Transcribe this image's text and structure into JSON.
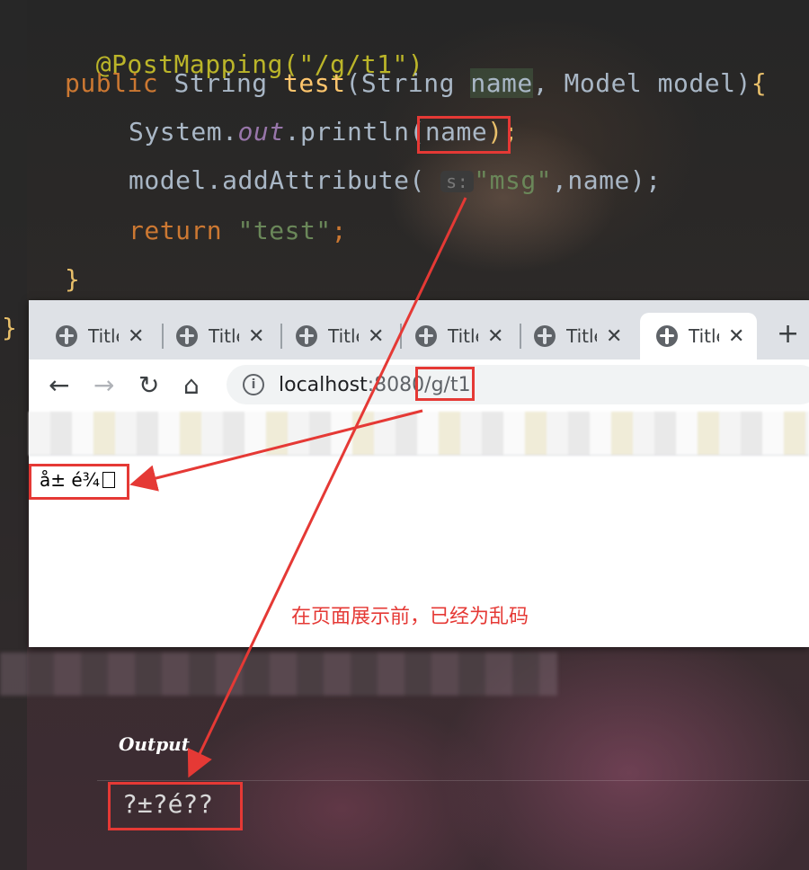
{
  "editor": {
    "annotation": "@PostMapping(\"/g/t1\")",
    "signature": {
      "kw": "public",
      "ret_type": "String",
      "method": "test",
      "param1_type": "String",
      "param1_name": "name",
      "param2_type": "Model",
      "param2_name": "model"
    },
    "line_println": {
      "obj": "System.",
      "field": "out",
      "call": ".println(",
      "arg": "name",
      "close": ");"
    },
    "line_addattr": {
      "prefix": "model.addAttribute(",
      "hint": "s:",
      "key": "\"msg\"",
      "rest": ",name);"
    },
    "line_return": {
      "kw": "return",
      "value": "\"test\"",
      "semi": ";"
    },
    "close_inner": "}",
    "close_outer": "}"
  },
  "browser": {
    "tabs": [
      {
        "title": "Title"
      },
      {
        "title": "Title"
      },
      {
        "title": "Title"
      },
      {
        "title": "Title"
      },
      {
        "title": "Title"
      },
      {
        "title": "Title",
        "active": true
      }
    ],
    "tab_close": "✕",
    "new_tab": "+",
    "nav": {
      "back": "←",
      "forward": "→",
      "reload": "↻",
      "home": "⌂"
    },
    "url_host": "localhost",
    "url_rest": ":8080/g/t1",
    "page_text": "å± é¾"
  },
  "annotation_note": "在页面展示前，已经为乱码",
  "output": {
    "label": "Output",
    "value": "?±?é??"
  },
  "colors": {
    "callout": "#e53935"
  }
}
